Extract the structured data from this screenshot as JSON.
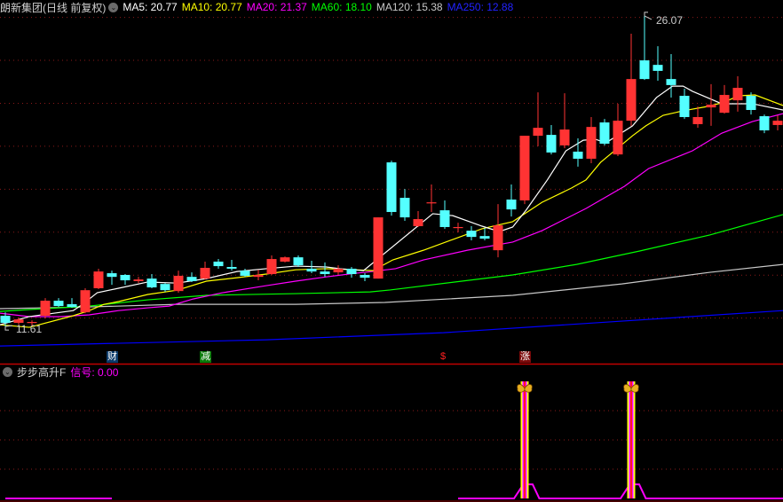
{
  "header": {
    "title": "朗新集团(日线 前复权)",
    "ma": [
      {
        "label": "MA5: 20.77",
        "color": "#ffffff"
      },
      {
        "label": "MA10: 20.77",
        "color": "#ffff00"
      },
      {
        "label": "MA20: 21.37",
        "color": "#ff00ff"
      },
      {
        "label": "MA60: 18.10",
        "color": "#00ff00"
      },
      {
        "label": "MA120: 15.38",
        "color": "#c8c8c8"
      },
      {
        "label": "MA250: 12.88",
        "color": "#0000ff"
      }
    ]
  },
  "indicator": {
    "name": "步步高升F",
    "signal_label": "信号: 0.00"
  },
  "markers": [
    {
      "text": "财",
      "index": 8,
      "bg": "#0a3a6a",
      "fg": "#ffffff"
    },
    {
      "text": "减",
      "index": 15,
      "bg": "#0a7a0a",
      "fg": "#ffffff"
    },
    {
      "text": "$",
      "index": 33,
      "bg": "transparent",
      "fg": "#ff2020"
    },
    {
      "text": "涨",
      "index": 39,
      "bg": "#7a0a0a",
      "fg": "#ffffff"
    }
  ],
  "colors": {
    "up": "#ff3333",
    "down": "#54ffff",
    "grid": "#8b1a1a",
    "separator": "#c00000"
  },
  "chart_data": {
    "type": "candlestick",
    "ylim": [
      9.88,
      26.81
    ],
    "gridlines": [
      12,
      14,
      16,
      18,
      20,
      22,
      24,
      26
    ],
    "annotations": [
      {
        "text": "26.07",
        "index": 48,
        "price": 26.07
      },
      {
        "text": "11.61",
        "index": 0,
        "price": 11.61
      }
    ],
    "candles": [
      [
        12.11,
        12.27,
        11.61,
        11.78
      ],
      [
        11.78,
        12.02,
        11.69,
        11.94
      ],
      [
        11.78,
        11.9,
        11.65,
        11.82
      ],
      [
        12.11,
        12.93,
        11.98,
        12.81
      ],
      [
        12.81,
        12.93,
        12.52,
        12.56
      ],
      [
        12.65,
        12.93,
        12.48,
        12.52
      ],
      [
        12.27,
        13.39,
        12.23,
        13.3
      ],
      [
        13.39,
        14.3,
        13.35,
        14.17
      ],
      [
        14.09,
        14.21,
        13.55,
        13.92
      ],
      [
        14.01,
        14.05,
        13.55,
        13.76
      ],
      [
        13.72,
        13.92,
        13.63,
        13.8
      ],
      [
        13.84,
        14.05,
        13.39,
        13.43
      ],
      [
        13.59,
        13.63,
        13.22,
        13.3
      ],
      [
        13.26,
        14.21,
        13.18,
        13.97
      ],
      [
        13.92,
        14.13,
        13.68,
        13.72
      ],
      [
        13.84,
        14.63,
        13.8,
        14.34
      ],
      [
        14.63,
        14.75,
        14.3,
        14.42
      ],
      [
        14.38,
        14.71,
        14.21,
        14.3
      ],
      [
        14.21,
        14.3,
        13.92,
        13.97
      ],
      [
        13.92,
        14.25,
        13.76,
        14.01
      ],
      [
        14.05,
        14.92,
        14.01,
        14.75
      ],
      [
        14.63,
        14.87,
        14.59,
        14.83
      ],
      [
        14.83,
        14.92,
        14.38,
        14.46
      ],
      [
        14.3,
        14.67,
        14.09,
        14.17
      ],
      [
        14.17,
        14.59,
        13.92,
        14.05
      ],
      [
        14.13,
        14.46,
        14.01,
        14.3
      ],
      [
        14.3,
        14.38,
        13.88,
        14.05
      ],
      [
        14.01,
        14.09,
        13.72,
        13.88
      ],
      [
        13.84,
        16.69,
        13.84,
        16.69
      ],
      [
        19.25,
        19.33,
        16.77,
        16.94
      ],
      [
        17.6,
        18.01,
        16.53,
        16.69
      ],
      [
        16.28,
        16.98,
        16.24,
        16.61
      ],
      [
        17.35,
        18.22,
        16.94,
        17.39
      ],
      [
        17.02,
        17.48,
        16.15,
        16.24
      ],
      [
        16.2,
        16.44,
        15.99,
        16.24
      ],
      [
        16.07,
        16.28,
        15.62,
        15.78
      ],
      [
        15.82,
        16.2,
        15.62,
        15.7
      ],
      [
        15.16,
        17.31,
        14.83,
        16.32
      ],
      [
        17.52,
        18.22,
        16.73,
        17.06
      ],
      [
        17.48,
        20.49,
        17.31,
        20.49
      ],
      [
        20.49,
        22.51,
        20.0,
        20.86
      ],
      [
        20.53,
        20.99,
        19.62,
        19.71
      ],
      [
        20.04,
        22.47,
        19.91,
        20.78
      ],
      [
        19.75,
        20.37,
        19.05,
        19.42
      ],
      [
        19.42,
        21.36,
        19.21,
        20.9
      ],
      [
        21.11,
        21.27,
        20.04,
        20.12
      ],
      [
        19.62,
        21.98,
        19.54,
        21.19
      ],
      [
        21.19,
        25.24,
        20.95,
        23.13
      ],
      [
        24.0,
        26.07,
        23.09,
        23.13
      ],
      [
        23.79,
        24.66,
        23.05,
        23.51
      ],
      [
        23.13,
        24.29,
        22.27,
        22.85
      ],
      [
        22.35,
        22.68,
        21.27,
        21.36
      ],
      [
        21.03,
        21.85,
        20.86,
        21.36
      ],
      [
        21.81,
        22.89,
        20.95,
        21.94
      ],
      [
        21.56,
        22.85,
        21.52,
        22.39
      ],
      [
        22.14,
        23.26,
        21.61,
        22.72
      ],
      [
        22.35,
        22.51,
        21.48,
        21.69
      ],
      [
        21.4,
        21.48,
        20.61,
        20.74
      ],
      [
        20.99,
        21.44,
        20.74,
        21.19
      ]
    ],
    "candle_fields": [
      "open",
      "high",
      "low",
      "close"
    ],
    "ma_series": [
      {
        "name": "MA5",
        "color": "#ffffff",
        "points": [
          [
            -0.4,
            11.69
          ],
          [
            1.8,
            12.07
          ],
          [
            5.1,
            12.35
          ],
          [
            5.8,
            12.64
          ],
          [
            6.9,
            13.18
          ],
          [
            8.5,
            13.39
          ],
          [
            10.7,
            13.68
          ],
          [
            12.9,
            13.63
          ],
          [
            15.1,
            13.84
          ],
          [
            17.4,
            14.17
          ],
          [
            19.6,
            14.3
          ],
          [
            21.8,
            14.42
          ],
          [
            24.1,
            14.38
          ],
          [
            25.1,
            14.3
          ],
          [
            26.9,
            14.21
          ],
          [
            32.1,
            16.86
          ],
          [
            33.6,
            16.77
          ],
          [
            35.8,
            16.28
          ],
          [
            37.1,
            16.03
          ],
          [
            38.1,
            16.24
          ],
          [
            39.1,
            17.02
          ],
          [
            40.7,
            18.43
          ],
          [
            42.1,
            19.79
          ],
          [
            43.4,
            20.28
          ],
          [
            44.3,
            20.33
          ],
          [
            45.1,
            20.16
          ],
          [
            47.1,
            20.95
          ],
          [
            48.9,
            22.27
          ],
          [
            50.1,
            22.8
          ],
          [
            50.9,
            22.8
          ],
          [
            51.6,
            22.56
          ],
          [
            52.7,
            22.27
          ],
          [
            53.8,
            21.98
          ],
          [
            56.1,
            21.98
          ],
          [
            58.4,
            21.69
          ]
        ]
      },
      {
        "name": "MA10",
        "color": "#ffff00",
        "points": [
          [
            -0.4,
            11.69
          ],
          [
            1.8,
            11.57
          ],
          [
            5.1,
            12.11
          ],
          [
            6.3,
            12.35
          ],
          [
            7.4,
            12.64
          ],
          [
            8.5,
            12.77
          ],
          [
            10.7,
            13.1
          ],
          [
            12.9,
            13.3
          ],
          [
            15.1,
            13.72
          ],
          [
            17.4,
            13.88
          ],
          [
            19.6,
            14.05
          ],
          [
            21.8,
            14.25
          ],
          [
            24.1,
            14.3
          ],
          [
            26.3,
            14.25
          ],
          [
            27.6,
            14.21
          ],
          [
            29.1,
            14.71
          ],
          [
            31.4,
            15.16
          ],
          [
            33.6,
            15.66
          ],
          [
            35.8,
            16.16
          ],
          [
            38.1,
            16.49
          ],
          [
            40.3,
            17.39
          ],
          [
            42.5,
            18.05
          ],
          [
            43.6,
            18.43
          ],
          [
            44.7,
            19.25
          ],
          [
            47.1,
            20.49
          ],
          [
            48.1,
            20.95
          ],
          [
            49.4,
            21.44
          ],
          [
            50.9,
            21.65
          ],
          [
            52.7,
            21.85
          ],
          [
            53.8,
            22.02
          ],
          [
            55.1,
            22.35
          ],
          [
            56.3,
            22.39
          ],
          [
            58.4,
            21.9
          ]
        ]
      },
      {
        "name": "MA20",
        "color": "#ff00ff",
        "points": [
          [
            -0.4,
            12.23
          ],
          [
            1.8,
            12.07
          ],
          [
            4.1,
            12.07
          ],
          [
            6.3,
            12.15
          ],
          [
            8.5,
            12.35
          ],
          [
            10.7,
            12.48
          ],
          [
            12.3,
            12.56
          ],
          [
            14.1,
            12.89
          ],
          [
            16.3,
            13.18
          ],
          [
            19.6,
            13.51
          ],
          [
            21.8,
            13.72
          ],
          [
            24.1,
            13.92
          ],
          [
            26.3,
            14.09
          ],
          [
            27.0,
            14.13
          ],
          [
            29.3,
            14.3
          ],
          [
            31.4,
            14.71
          ],
          [
            34.7,
            15.16
          ],
          [
            38.1,
            15.54
          ],
          [
            40.3,
            16.07
          ],
          [
            43.6,
            17.1
          ],
          [
            46.5,
            18.14
          ],
          [
            48.3,
            18.96
          ],
          [
            51.6,
            19.79
          ],
          [
            53.8,
            20.61
          ],
          [
            56.1,
            21.15
          ],
          [
            58.4,
            21.52
          ]
        ]
      },
      {
        "name": "MA60",
        "color": "#00ff00",
        "points": [
          [
            -0.4,
            12.31
          ],
          [
            1.8,
            12.4
          ],
          [
            6.3,
            12.56
          ],
          [
            10.7,
            12.85
          ],
          [
            15.1,
            13.06
          ],
          [
            21.8,
            13.14
          ],
          [
            27.4,
            13.22
          ],
          [
            28.9,
            13.31
          ],
          [
            38.1,
            14.01
          ],
          [
            42.9,
            14.5
          ],
          [
            47.6,
            15.12
          ],
          [
            52.9,
            15.87
          ],
          [
            58.4,
            16.82
          ]
        ]
      },
      {
        "name": "MA120",
        "color": "#c8c8c8",
        "points": [
          [
            -0.4,
            12.44
          ],
          [
            6.3,
            12.52
          ],
          [
            12.9,
            12.64
          ],
          [
            21.8,
            12.64
          ],
          [
            28.5,
            12.73
          ],
          [
            38.1,
            13.06
          ],
          [
            46.3,
            13.59
          ],
          [
            52.9,
            14.13
          ],
          [
            58.4,
            14.5
          ]
        ]
      },
      {
        "name": "MA250",
        "color": "#0000ff",
        "points": [
          [
            -0.4,
            10.7
          ],
          [
            19.6,
            10.99
          ],
          [
            32.9,
            11.32
          ],
          [
            46.3,
            11.86
          ],
          [
            58.4,
            12.35
          ]
        ]
      }
    ],
    "indicator": {
      "type": "bar+line",
      "ylim": [
        0,
        1
      ],
      "signal_indices": [
        39,
        47
      ],
      "line_segments": [
        [
          [
            0,
            0
          ],
          [
            8,
            0
          ]
        ],
        [
          [
            34,
            0
          ],
          [
            38.2,
            0
          ],
          [
            38.9,
            0.12
          ],
          [
            39.6,
            0.12
          ],
          [
            40.1,
            0
          ],
          [
            46.2,
            0
          ],
          [
            46.9,
            0.12
          ],
          [
            47.6,
            0.12
          ],
          [
            48.1,
            0
          ],
          [
            58.4,
            0
          ]
        ]
      ]
    }
  }
}
